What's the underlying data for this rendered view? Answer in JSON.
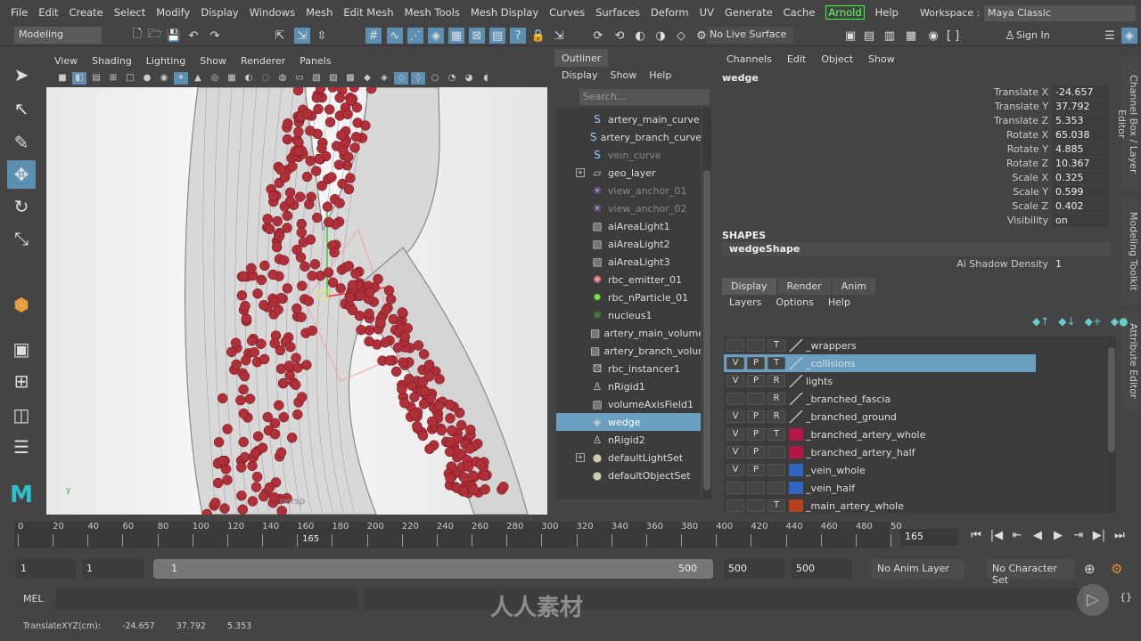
{
  "menubar": {
    "items": [
      "File",
      "Edit",
      "Create",
      "Select",
      "Modify",
      "Display",
      "Windows",
      "Mesh",
      "Edit Mesh",
      "Mesh Tools",
      "Mesh Display",
      "Curves",
      "Surfaces",
      "Deform",
      "UV",
      "Generate",
      "Cache",
      "Arnold",
      "Help"
    ],
    "workspace_label": "Workspace :",
    "workspace_value": "Maya Classic"
  },
  "toolbar": {
    "mode": "Modeling",
    "live_surface": "No Live Surface",
    "sign_in": "Sign In"
  },
  "viewport": {
    "menu": [
      "View",
      "Shading",
      "Lighting",
      "Show",
      "Renderer",
      "Panels"
    ],
    "camera_label": "persp"
  },
  "outliner": {
    "tab": "Outliner",
    "menu": [
      "Display",
      "Show",
      "Help"
    ],
    "search_placeholder": "Search...",
    "items": [
      {
        "label": "artery_main_curve",
        "icon": "curve-icon",
        "state": "normal"
      },
      {
        "label": "artery_branch_curve",
        "icon": "curve-icon",
        "state": "normal"
      },
      {
        "label": "vein_curve",
        "icon": "curve-icon",
        "state": "dim"
      },
      {
        "label": "geo_layer",
        "icon": "group-icon",
        "state": "normal",
        "expandable": true
      },
      {
        "label": "view_anchor_01",
        "icon": "locator-icon",
        "state": "dim"
      },
      {
        "label": "view_anchor_02",
        "icon": "locator-icon",
        "state": "dim"
      },
      {
        "label": "aiAreaLight1",
        "icon": "transform-icon",
        "state": "normal"
      },
      {
        "label": "aiAreaLight2",
        "icon": "transform-icon",
        "state": "normal"
      },
      {
        "label": "aiAreaLight3",
        "icon": "transform-icon",
        "state": "normal"
      },
      {
        "label": "rbc_emitter_01",
        "icon": "emitter-icon",
        "state": "normal"
      },
      {
        "label": "rbc_nParticle_01",
        "icon": "nparticle-icon",
        "state": "normal"
      },
      {
        "label": "nucleus1",
        "icon": "nucleus-icon",
        "state": "normal"
      },
      {
        "label": "artery_main_volume",
        "icon": "transform-icon",
        "state": "normal"
      },
      {
        "label": "artery_branch_volum",
        "icon": "transform-icon",
        "state": "normal"
      },
      {
        "label": "rbc_instancer1",
        "icon": "instancer-icon",
        "state": "normal"
      },
      {
        "label": "nRigid1",
        "icon": "nrigid-icon",
        "state": "normal"
      },
      {
        "label": "volumeAxisField1",
        "icon": "transform-icon",
        "state": "normal"
      },
      {
        "label": "wedge",
        "icon": "mesh-icon",
        "state": "selected"
      },
      {
        "label": "nRigid2",
        "icon": "nrigid-icon",
        "state": "normal"
      },
      {
        "label": "defaultLightSet",
        "icon": "set-icon",
        "state": "normal",
        "expandable": true
      },
      {
        "label": "defaultObjectSet",
        "icon": "set-icon",
        "state": "normal"
      }
    ]
  },
  "channel_box": {
    "menu": [
      "Channels",
      "Edit",
      "Object",
      "Show"
    ],
    "object": "wedge",
    "channels": [
      {
        "label": "Translate X",
        "value": "-24.657"
      },
      {
        "label": "Translate Y",
        "value": "37.792"
      },
      {
        "label": "Translate Z",
        "value": "5.353"
      },
      {
        "label": "Rotate X",
        "value": "65.038"
      },
      {
        "label": "Rotate Y",
        "value": "4.885"
      },
      {
        "label": "Rotate Z",
        "value": "10.367"
      },
      {
        "label": "Scale X",
        "value": "0.325"
      },
      {
        "label": "Scale Y",
        "value": "0.599"
      },
      {
        "label": "Scale Z",
        "value": "0.402"
      },
      {
        "label": "Visibility",
        "value": "on"
      }
    ],
    "shapes_header": "SHAPES",
    "shape": "wedgeShape",
    "shape_attr": {
      "label": "Ai Shadow Density",
      "value": "1"
    }
  },
  "side_tabs": [
    "Channel Box / Layer Editor",
    "Modeling Toolkit",
    "Attribute Editor"
  ],
  "layer_editor": {
    "tabs": [
      "Display",
      "Render",
      "Anim"
    ],
    "menu": [
      "Layers",
      "Options",
      "Help"
    ],
    "layers": [
      {
        "v": "",
        "p": "",
        "t": "T",
        "color": null,
        "name": "_wrappers"
      },
      {
        "v": "V",
        "p": "P",
        "t": "T",
        "color": null,
        "name": "_collisions",
        "selected": true
      },
      {
        "v": "V",
        "p": "P",
        "t": "R",
        "color": null,
        "name": "lights"
      },
      {
        "v": "",
        "p": "",
        "t": "R",
        "color": null,
        "name": "_branched_fascia"
      },
      {
        "v": "V",
        "p": "P",
        "t": "R",
        "color": null,
        "name": "_branched_ground"
      },
      {
        "v": "V",
        "p": "P",
        "t": "T",
        "color": "#b5164a",
        "name": "_branched_artery_whole"
      },
      {
        "v": "V",
        "p": "P",
        "t": "",
        "color": "#b5164a",
        "name": "_branched_artery_half"
      },
      {
        "v": "V",
        "p": "P",
        "t": "",
        "color": "#2f66c4",
        "name": "_vein_whole"
      },
      {
        "v": "",
        "p": "",
        "t": "",
        "color": "#2f66c4",
        "name": "_vein_half"
      },
      {
        "v": "",
        "p": "",
        "t": "T",
        "color": "#b8401f",
        "name": "_main_artery_whole"
      }
    ]
  },
  "timeline": {
    "ticks": [
      "0",
      "20",
      "40",
      "60",
      "80",
      "100",
      "120",
      "140",
      "160",
      "180",
      "200",
      "220",
      "240",
      "260",
      "280",
      "300",
      "320",
      "340",
      "360",
      "380",
      "400",
      "420",
      "440",
      "460",
      "480",
      "50"
    ],
    "current_frame": "165",
    "frame_field": "165"
  },
  "range": {
    "start": "1",
    "anim_start": "1",
    "slider_start": "1",
    "slider_end": "500",
    "anim_end": "500",
    "end": "500",
    "anim_layer": "No Anim Layer",
    "character_set": "No Character Set"
  },
  "command_line": {
    "label": "MEL"
  },
  "status_line": {
    "label": "TranslateXYZ(cm):",
    "x": "-24.657",
    "y": "37.792",
    "z": "5.353"
  },
  "watermark": "人人素材"
}
